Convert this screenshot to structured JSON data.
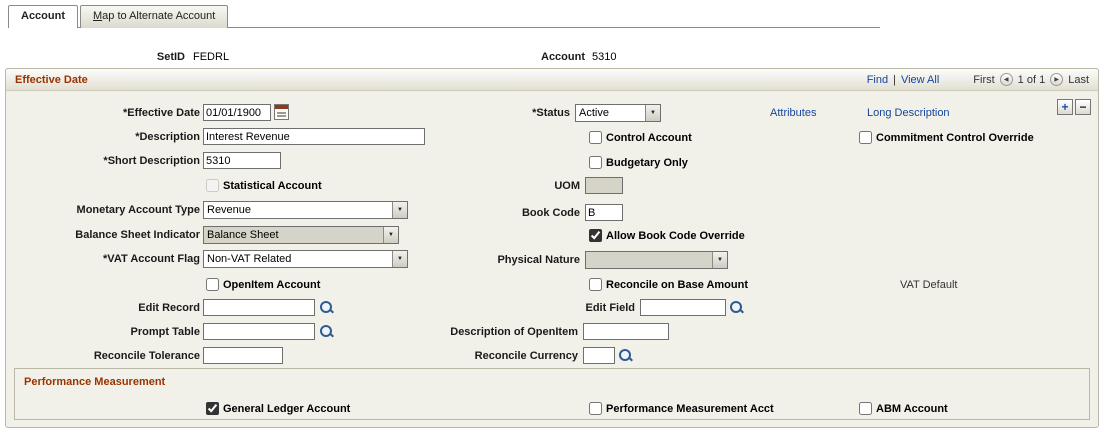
{
  "colors": {
    "section_title": "#993300",
    "link": "#15459c",
    "panel_bg": "#f2f1e9"
  },
  "tabs": {
    "account": "Account",
    "map_alternate": "Map to Alternate Account"
  },
  "keys": {
    "setid_label": "SetID",
    "setid_value": "FEDRL",
    "account_label": "Account",
    "account_value": "5310"
  },
  "section": {
    "title": "Effective Date",
    "nav": {
      "find": "Find",
      "divider": "|",
      "view_all": "View All",
      "first": "First",
      "position": "1 of 1",
      "last": "Last",
      "prev_icon": "◀",
      "next_icon": "▶"
    },
    "add_row": "+",
    "delete_row": "−"
  },
  "links": {
    "attributes": "Attributes",
    "long_description": "Long Description",
    "vat_default": "VAT Default"
  },
  "fields": {
    "effective_date": {
      "label": "*Effective Date",
      "value": "01/01/1900"
    },
    "status": {
      "label": "*Status",
      "value": "Active"
    },
    "description": {
      "label": "*Description",
      "value": "Interest Revenue"
    },
    "short_description": {
      "label": "*Short Description",
      "value": "5310"
    },
    "statistical_account": {
      "label": "Statistical Account",
      "checked": false
    },
    "uom": {
      "label": "UOM",
      "value": ""
    },
    "monetary_account_type": {
      "label": "Monetary Account Type",
      "value": "Revenue"
    },
    "book_code": {
      "label": "Book Code",
      "value": "B"
    },
    "balance_sheet_indicator": {
      "label": "Balance Sheet Indicator",
      "value": "Balance Sheet"
    },
    "allow_book_code_override": {
      "label": "Allow Book Code Override",
      "checked": true
    },
    "vat_account_flag": {
      "label": "*VAT Account Flag",
      "value": "Non-VAT Related"
    },
    "physical_nature": {
      "label": "Physical Nature",
      "value": ""
    },
    "openitem_account": {
      "label": "OpenItem Account",
      "checked": false
    },
    "reconcile_base": {
      "label": "Reconcile on Base Amount",
      "checked": false
    },
    "control_account": {
      "label": "Control Account",
      "checked": false
    },
    "budgetary_only": {
      "label": "Budgetary Only",
      "checked": false
    },
    "commitment_control_override": {
      "label": "Commitment Control Override",
      "checked": false
    },
    "edit_record": {
      "label": "Edit Record",
      "value": ""
    },
    "edit_field": {
      "label": "Edit Field",
      "value": ""
    },
    "prompt_table": {
      "label": "Prompt Table",
      "value": ""
    },
    "description_of_openitem": {
      "label": "Description of OpenItem",
      "value": ""
    },
    "reconcile_tolerance": {
      "label": "Reconcile Tolerance",
      "value": ""
    },
    "reconcile_currency": {
      "label": "Reconcile Currency",
      "value": ""
    }
  },
  "performance": {
    "title": "Performance Measurement",
    "general_ledger_account": {
      "label": "General Ledger Account",
      "checked": true
    },
    "performance_measurement_acct": {
      "label": "Performance Measurement Acct",
      "checked": false
    },
    "abm_account": {
      "label": "ABM Account",
      "checked": false
    }
  }
}
